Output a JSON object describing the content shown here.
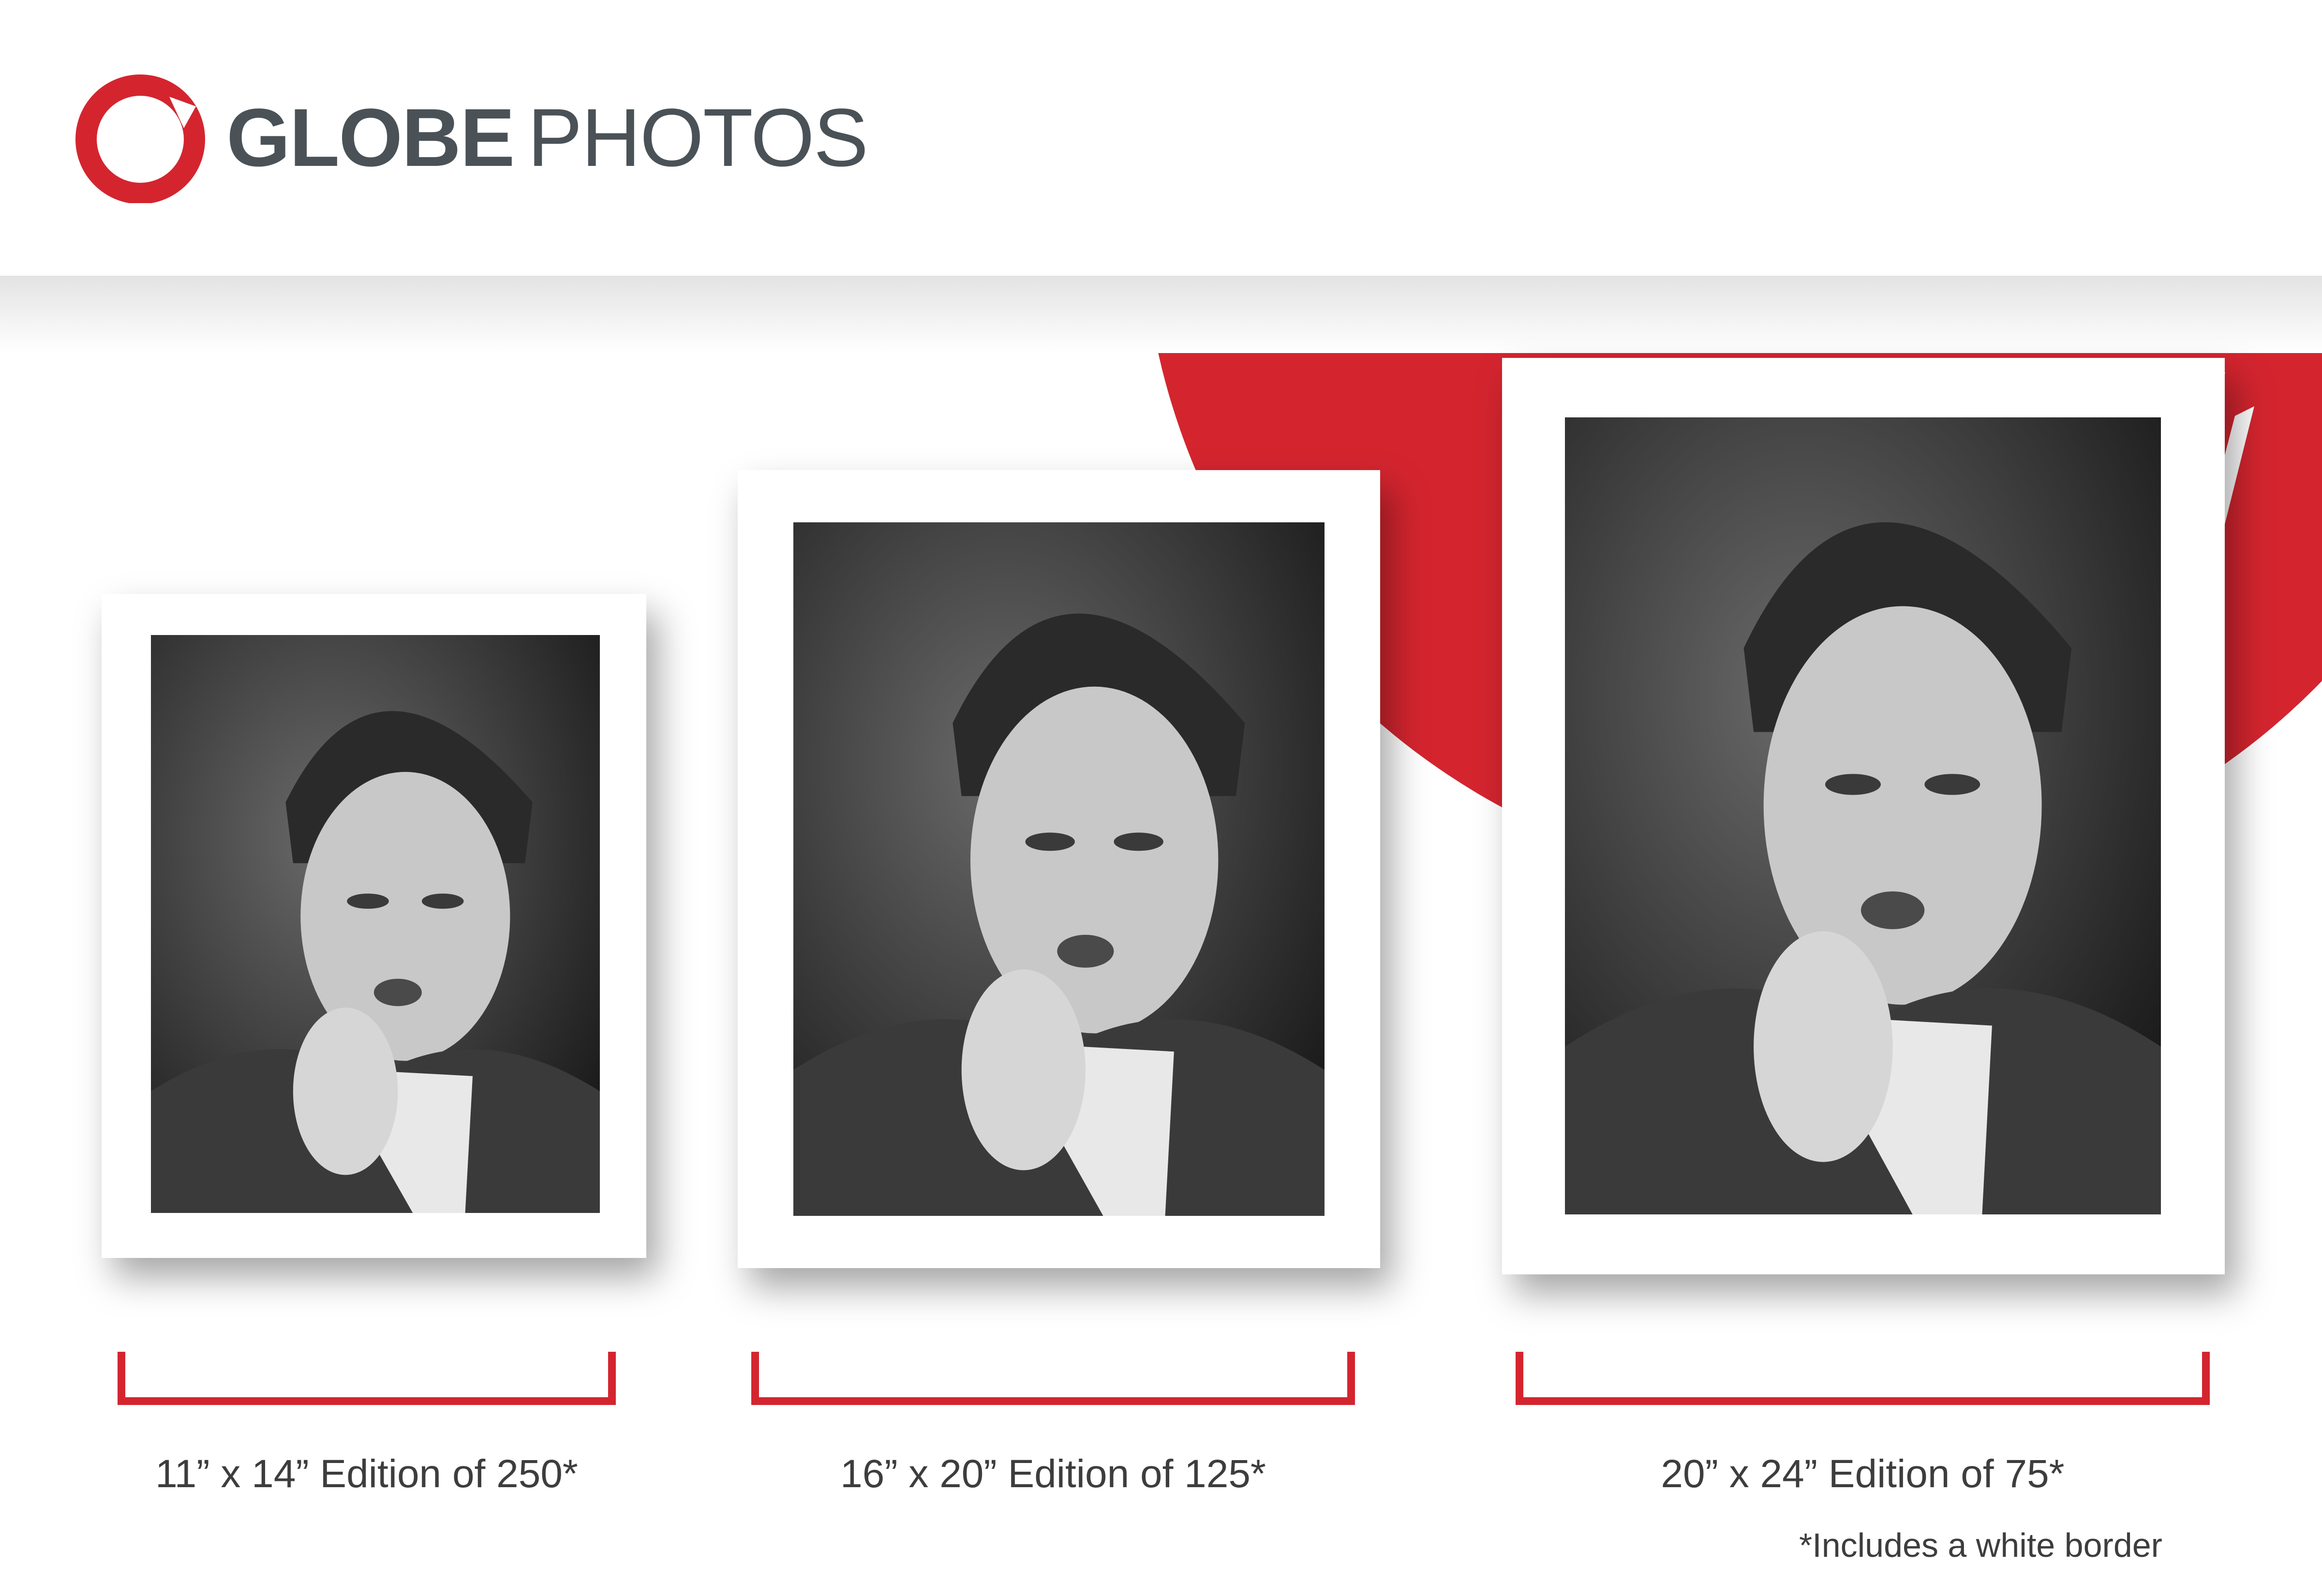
{
  "brand": {
    "name_bold": "GLOBE",
    "name_light": "PHOTOS",
    "logo_icon": "brush-circle-logo"
  },
  "colors": {
    "accent": "#d4252f",
    "text_dark": "#4a5257",
    "caption": "#3d3d3d"
  },
  "prints": [
    {
      "caption": "11” x 14” Edition of 250*"
    },
    {
      "caption": "16” x 20” Edition of 125*"
    },
    {
      "caption": "20” x 24” Edition of 75*"
    }
  ],
  "footnote": "*Includes a white border"
}
